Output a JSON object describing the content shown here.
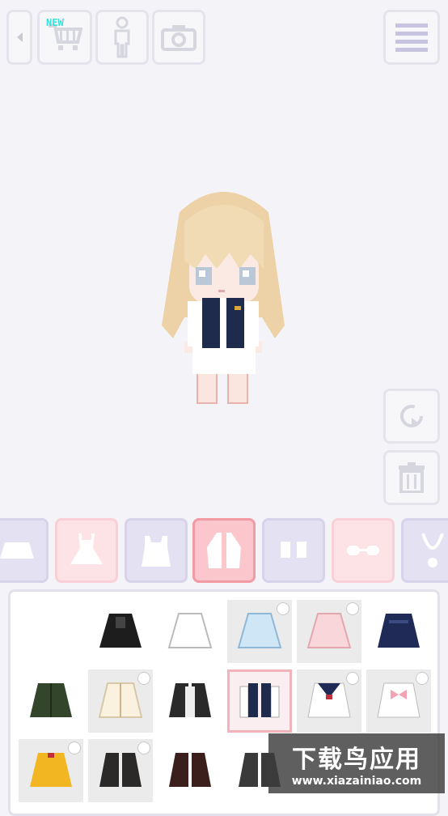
{
  "toolbar": {
    "new_badge": "NEW",
    "buttons": [
      "back-button",
      "shop-button",
      "body-button",
      "camera-button",
      "menu-button"
    ]
  },
  "side_actions": [
    "rotate-button",
    "trash-button"
  ],
  "category_tabs": [
    {
      "name": "skirt",
      "style": "lav"
    },
    {
      "name": "dress",
      "style": "pink"
    },
    {
      "name": "top",
      "style": "lav"
    },
    {
      "name": "jacket",
      "style": "sel",
      "selected": true
    },
    {
      "name": "socks",
      "style": "lav"
    },
    {
      "name": "glasses",
      "style": "pink"
    },
    {
      "name": "necklace",
      "style": "lav"
    }
  ],
  "items": [
    {
      "kind": "empty"
    },
    {
      "kind": "black-hoodie"
    },
    {
      "kind": "white-hoodie"
    },
    {
      "kind": "blue-hoodie",
      "locked": true
    },
    {
      "kind": "pink-hoodie",
      "locked": true
    },
    {
      "kind": "navy-sweater"
    },
    {
      "kind": "green-cardigan"
    },
    {
      "kind": "cream-cardigan",
      "locked": true
    },
    {
      "kind": "black-white-jacket"
    },
    {
      "kind": "varsity-jacket",
      "selected": true
    },
    {
      "kind": "sailor-top",
      "locked": true
    },
    {
      "kind": "pink-bow-top",
      "locked": true
    },
    {
      "kind": "yellow-coat",
      "locked": true
    },
    {
      "kind": "black-coat",
      "locked": true
    },
    {
      "kind": "brown-coat"
    },
    {
      "kind": "gray-coat"
    }
  ],
  "watermark": {
    "title": "下载鸟应用",
    "url": "www.xiazainiao.com"
  }
}
